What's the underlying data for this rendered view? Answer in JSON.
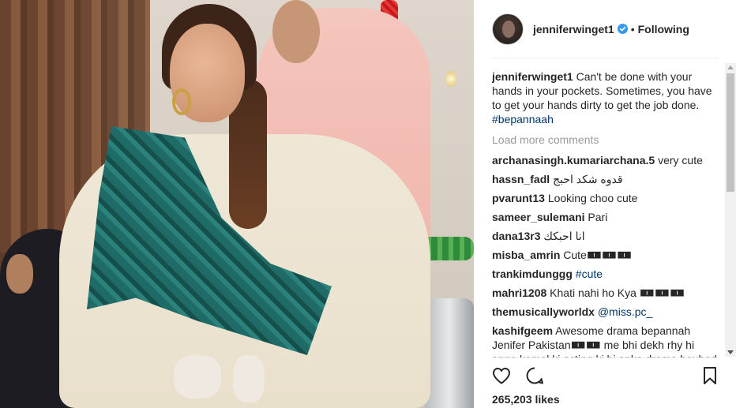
{
  "header": {
    "username": "jenniferwinget1",
    "separator": "•",
    "follow_status": "Following"
  },
  "caption": {
    "username": "jenniferwinget1",
    "text": "Can't be done with your hands in your pockets. Sometimes, you have to get your hands dirty to get the job done.",
    "hashtag": "#bepannaah"
  },
  "load_more": "Load more comments",
  "comments": [
    {
      "username": "archanasingh.kumariarchana.5",
      "text": "very cute"
    },
    {
      "username": "hassn_fadl",
      "text": "قدوه شكد احبج"
    },
    {
      "username": "pvarunt13",
      "text": "Looking choo cute"
    },
    {
      "username": "sameer_sulemani",
      "text": "Pari"
    },
    {
      "username": "dana13r3",
      "text": "انا احبكك"
    },
    {
      "username": "misba_amrin",
      "text": "Cute🀰🀰🀰"
    },
    {
      "username": "trankimdunggg",
      "text": "",
      "tag": "#cute"
    },
    {
      "username": "mahri1208",
      "text": "Khati nahi ho Kya 🀰🀰🀰"
    },
    {
      "username": "themusicallyworldx",
      "text": "",
      "tag": "@miss.pc_"
    },
    {
      "username": "kashifgeem",
      "text": "Awesome drama bepannah Jenifer Pakistan🀰🀰 me bhi dekh rhy hi apne kamal ki acting ki hi apka drama bouhad"
    }
  ],
  "likes": "265,203 likes",
  "icons": {
    "verified": "verified-badge-icon",
    "like": "heart-icon",
    "comment": "comment-bubble-icon",
    "save": "bookmark-icon"
  },
  "colors": {
    "verified": "#3897f0",
    "text": "#262626",
    "muted": "#999999",
    "link": "#003569"
  }
}
